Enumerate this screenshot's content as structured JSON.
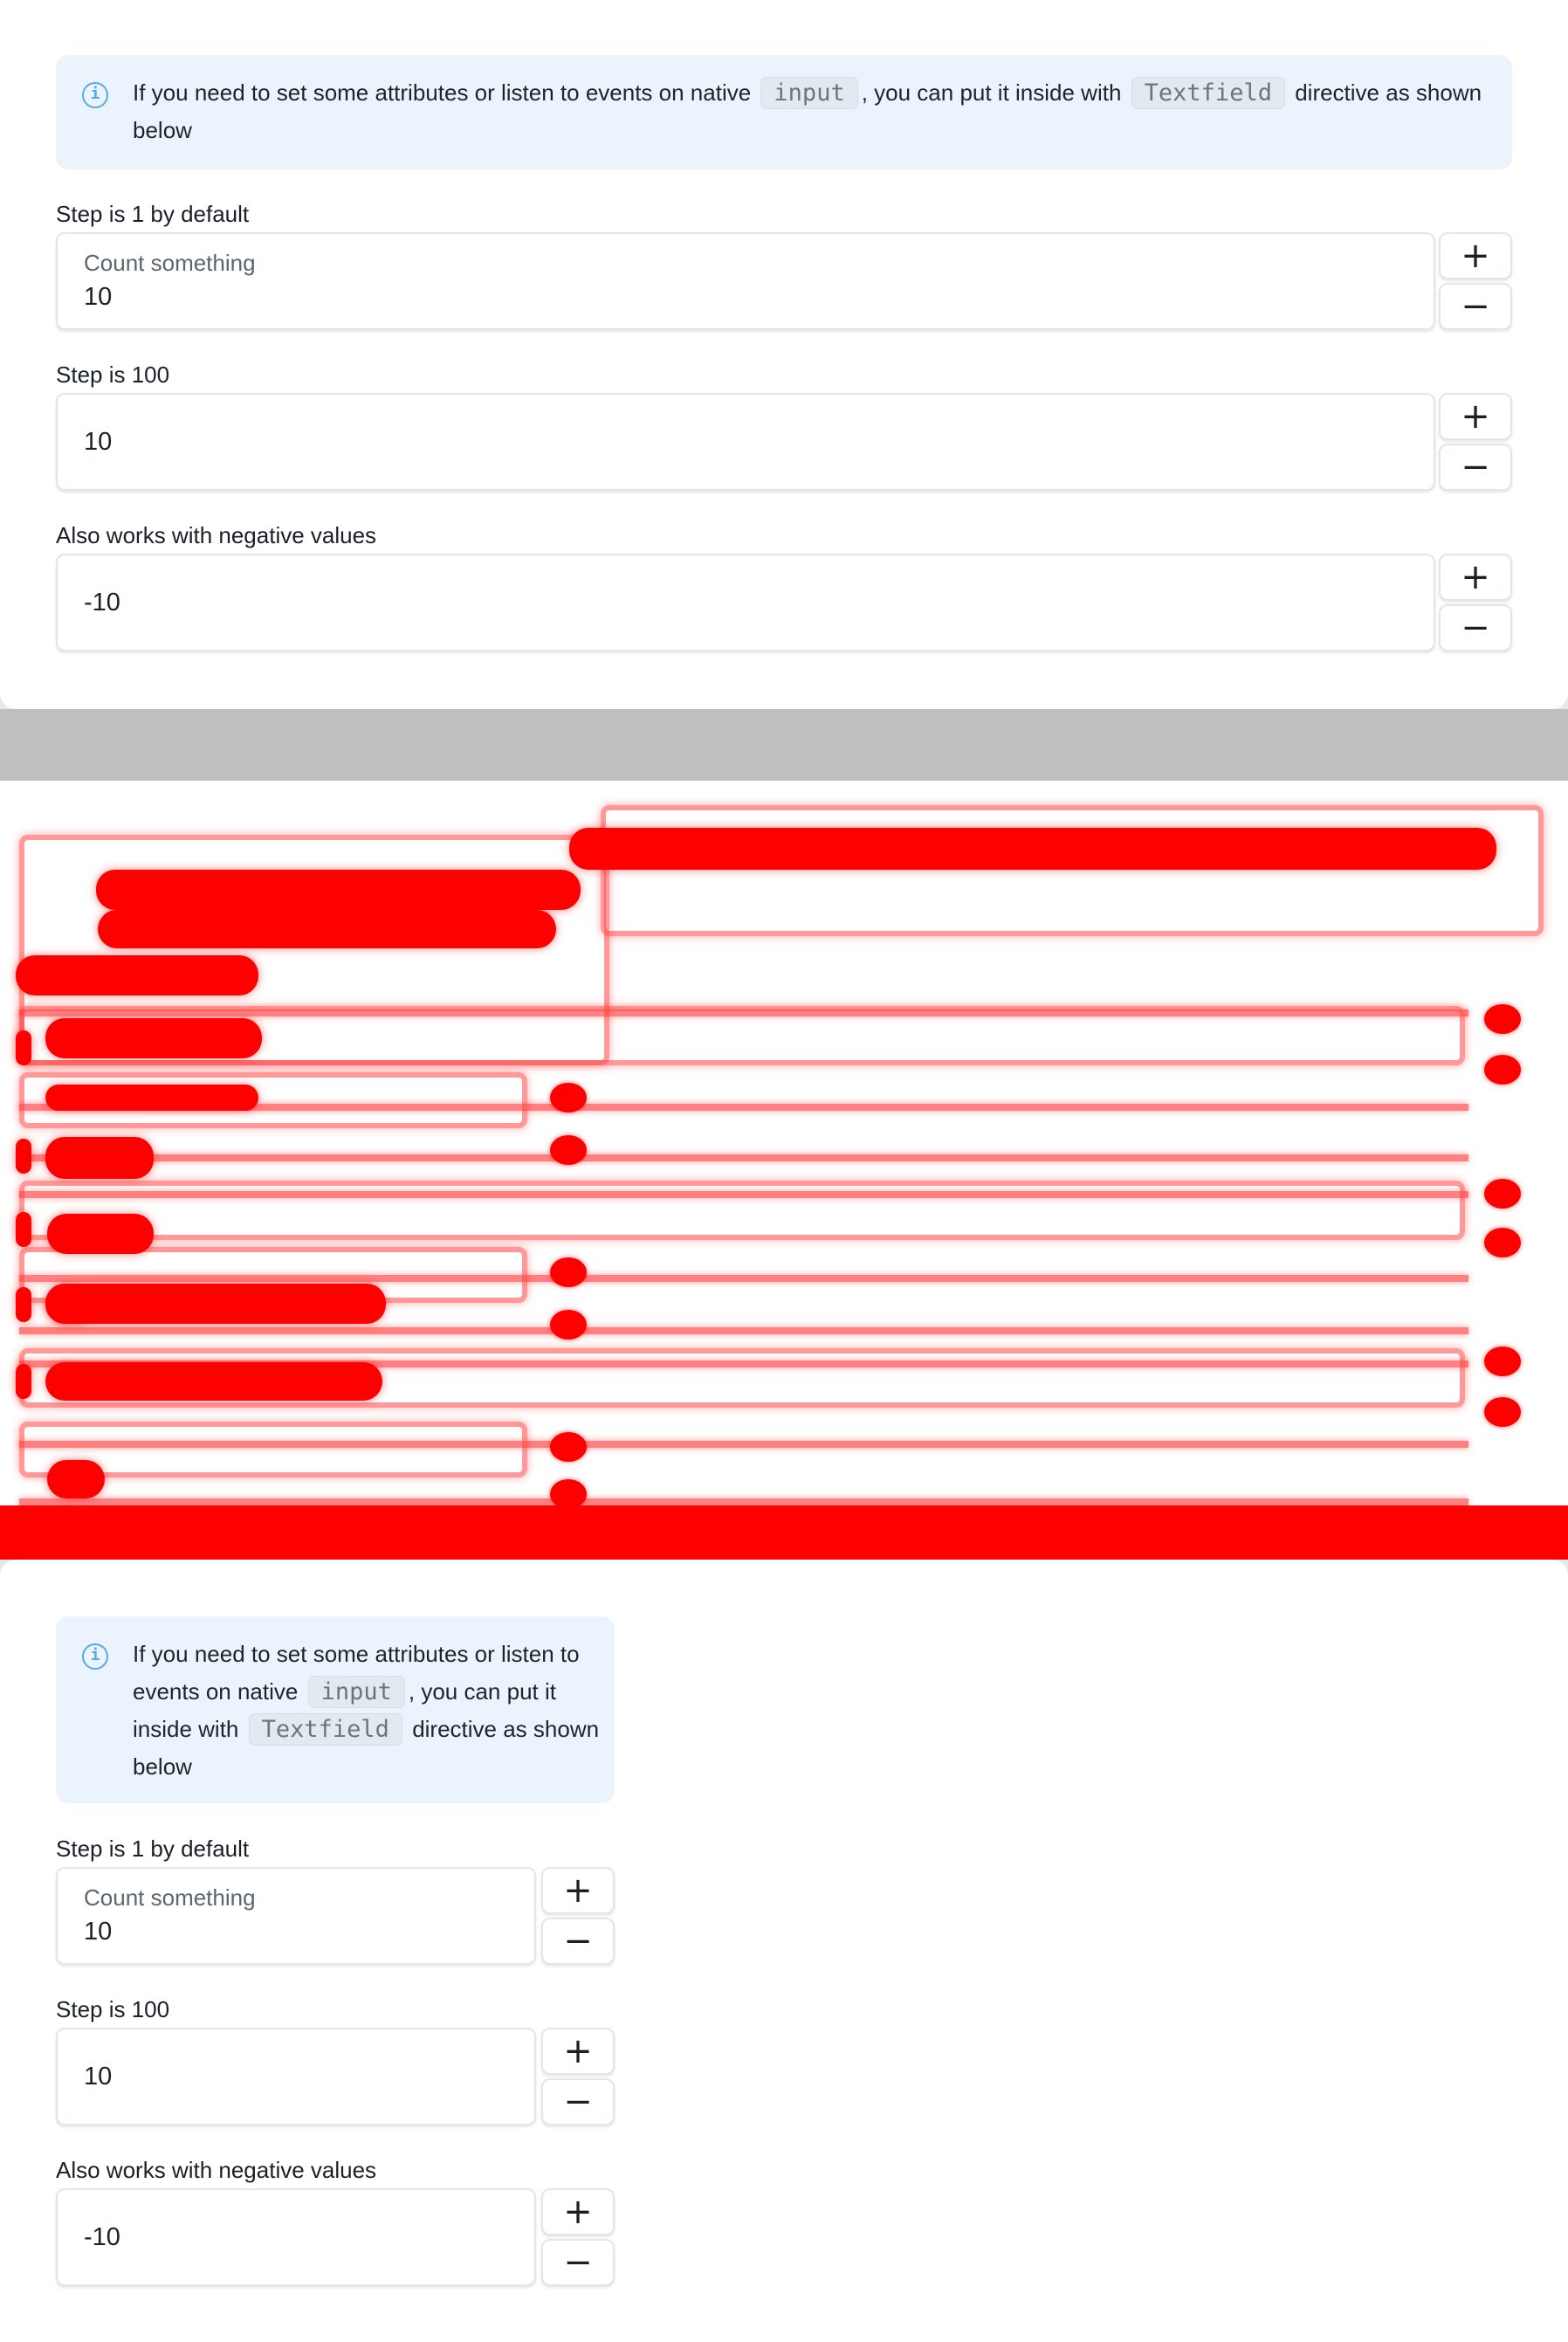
{
  "demo": {
    "notice": {
      "icon": "info-icon",
      "text_part1": "If you need to set some attributes or listen to events on native",
      "code1": "input",
      "text_part2": ", you can put it inside with",
      "code2": "Textfield",
      "text_part3": "directive as shown below"
    },
    "fields": [
      {
        "label": "Step is 1 by default",
        "placeholder": "Count something",
        "value": "10",
        "plus": "+",
        "minus": "−"
      },
      {
        "label": "Step is 100",
        "placeholder": "",
        "value": "10",
        "plus": "+",
        "minus": "−"
      },
      {
        "label": "Also works with negative values",
        "placeholder": "",
        "value": "-10",
        "plus": "+",
        "minus": "−"
      }
    ]
  },
  "colors": {
    "notice_bg": "#ebf4fc",
    "info_icon": "#5aa8ec",
    "overlay_red": "#ff0000",
    "band_gray": "#bfbfbf"
  }
}
